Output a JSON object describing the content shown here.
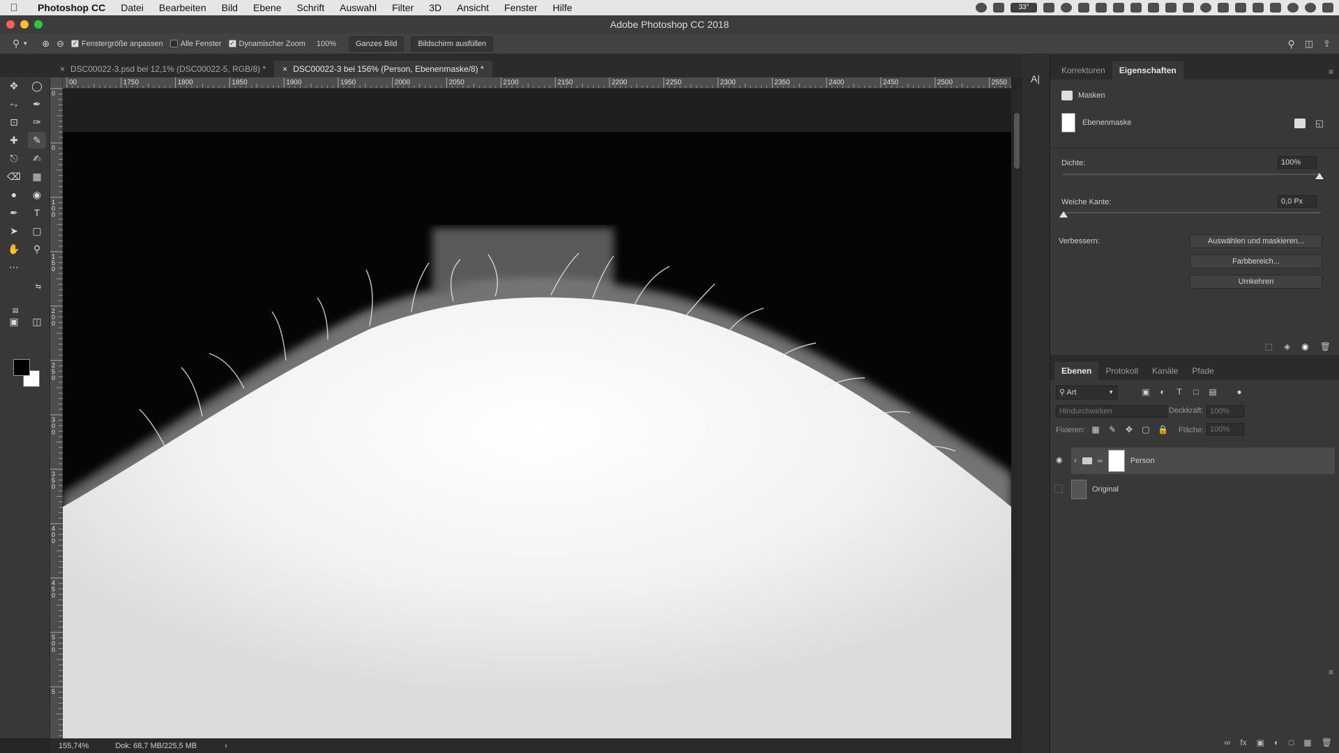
{
  "menubar": {
    "app": "Photoshop CC",
    "items": [
      "Datei",
      "Bearbeiten",
      "Bild",
      "Ebene",
      "Schrift",
      "Auswahl",
      "Filter",
      "3D",
      "Ansicht",
      "Fenster",
      "Hilfe"
    ],
    "temp": "33°"
  },
  "window": {
    "title": "Adobe Photoshop CC 2018"
  },
  "options": {
    "fit_window": "Fenstergröße anpassen",
    "all_windows": "Alle Fenster",
    "dynamic_zoom": "Dynamischer Zoom",
    "zoom_value": "100%",
    "whole_image": "Ganzes Bild",
    "fill_screen": "Bildschirm ausfüllen"
  },
  "tabs": [
    {
      "label": "DSC00022-3.psd bei 12,1% (DSC00022-5, RGB/8) *"
    },
    {
      "label": "DSC00022-3 bei 156% (Person, Ebenenmaske/8) *"
    }
  ],
  "ruler": {
    "top_ticks": [
      "00",
      "1750",
      "1800",
      "1850",
      "1900",
      "1950",
      "2000",
      "2050",
      "2100",
      "2150",
      "2200",
      "2250",
      "2300",
      "2350",
      "2400",
      "2450",
      "2500",
      "2550"
    ],
    "left_ticks": [
      "0",
      "0",
      "1\n0\n0",
      "1\n5\n0",
      "2\n0\n0",
      "2\n5\n0",
      "3\n0\n0",
      "3\n5\n0",
      "4\n0\n0",
      "4\n5\n0",
      "5\n0\n0",
      "5"
    ]
  },
  "status": {
    "zoom": "155,74%",
    "doc": "Dok: 68,7 MB/225,5 MB"
  },
  "properties": {
    "tabs": [
      "Korrekturen",
      "Eigenschaften"
    ],
    "section": "Masken",
    "mask_label": "Ebenenmaske",
    "density_label": "Dichte:",
    "density_value": "100%",
    "feather_label": "Weiche Kante:",
    "feather_value": "0,0 Px",
    "refine_label": "Verbessern:",
    "btn_select_mask": "Auswählen und maskieren...",
    "btn_color_range": "Farbbereich...",
    "btn_invert": "Umkehren"
  },
  "layers": {
    "tabs": [
      "Ebenen",
      "Protokoll",
      "Kanäle",
      "Pfade"
    ],
    "filter_kind": "Art",
    "blend_mode": "Hindurchwirken",
    "opacity_label": "Deckkraft:",
    "opacity_value": "100%",
    "lock_label": "Fixieren:",
    "fill_label": "Fläche:",
    "fill_value": "100%",
    "rows": [
      {
        "name": "Person"
      },
      {
        "name": "Original"
      }
    ]
  }
}
